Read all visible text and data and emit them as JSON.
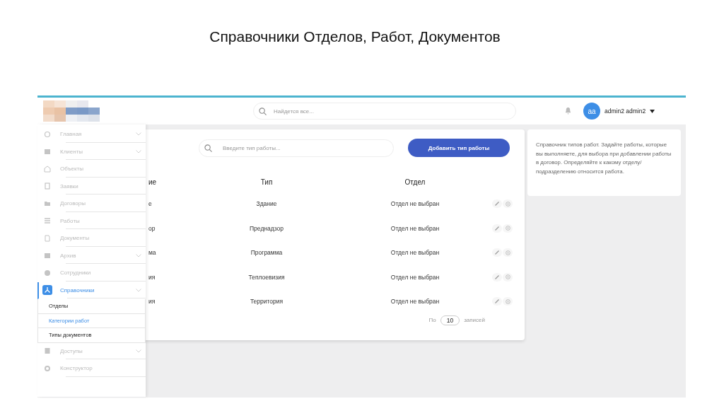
{
  "slide_title": "Справочники Отделов, Работ, Документов",
  "header": {
    "search_placeholder": "Найдется все...",
    "avatar_initials": "aa",
    "user_name": "admin2 admin2"
  },
  "sidebar": {
    "items": [
      {
        "label": "Главная",
        "selected": false,
        "expandable": true
      },
      {
        "label": "Клиенты",
        "selected": false,
        "expandable": true
      },
      {
        "label": "Объекты",
        "selected": false,
        "expandable": false
      },
      {
        "label": "Заявки",
        "selected": false,
        "expandable": false
      },
      {
        "label": "Договоры",
        "selected": false,
        "expandable": false
      },
      {
        "label": "Работы",
        "selected": false,
        "expandable": false
      },
      {
        "label": "Документы",
        "selected": false,
        "expandable": false
      },
      {
        "label": "Архив",
        "selected": false,
        "expandable": true
      },
      {
        "label": "Сотрудники",
        "selected": false,
        "expandable": false
      },
      {
        "label": "Справочники",
        "selected": true,
        "expandable": true,
        "children": [
          {
            "label": "Отделы",
            "selected": false
          },
          {
            "label": "Категории работ",
            "selected": true
          },
          {
            "label": "Типы документов",
            "selected": false
          }
        ]
      },
      {
        "label": "Доступы",
        "selected": false,
        "expandable": true
      },
      {
        "label": "Конструктор",
        "selected": false,
        "expandable": false
      }
    ]
  },
  "main": {
    "search_placeholder": "Введите тип работы...",
    "add_button": "Добавить тип работы",
    "columns": [
      "ие",
      "Тип",
      "Отдел"
    ],
    "rows": [
      {
        "column_1": "е",
        "type": "Здание",
        "department": "Отдел не выбран"
      },
      {
        "column_1": "ор",
        "type": "Преднадзор",
        "department": "Отдел не выбран"
      },
      {
        "column_1": "ма",
        "type": "Программа",
        "department": "Отдел не выбран"
      },
      {
        "column_1": "ия",
        "type": "Теплоевизия",
        "department": "Отдел не выбран"
      },
      {
        "column_1": "ия",
        "type": "Территория",
        "department": "Отдел не выбран"
      }
    ],
    "pagination": {
      "prefix": "По",
      "per_page": "10",
      "suffix": "записей"
    }
  },
  "info": {
    "text": "Справочник типов работ. Задайте работы, которые вы выполняете, для выбора при добавлении работы в договор. Определяйте к какому отделу/подразделению относится работа."
  }
}
